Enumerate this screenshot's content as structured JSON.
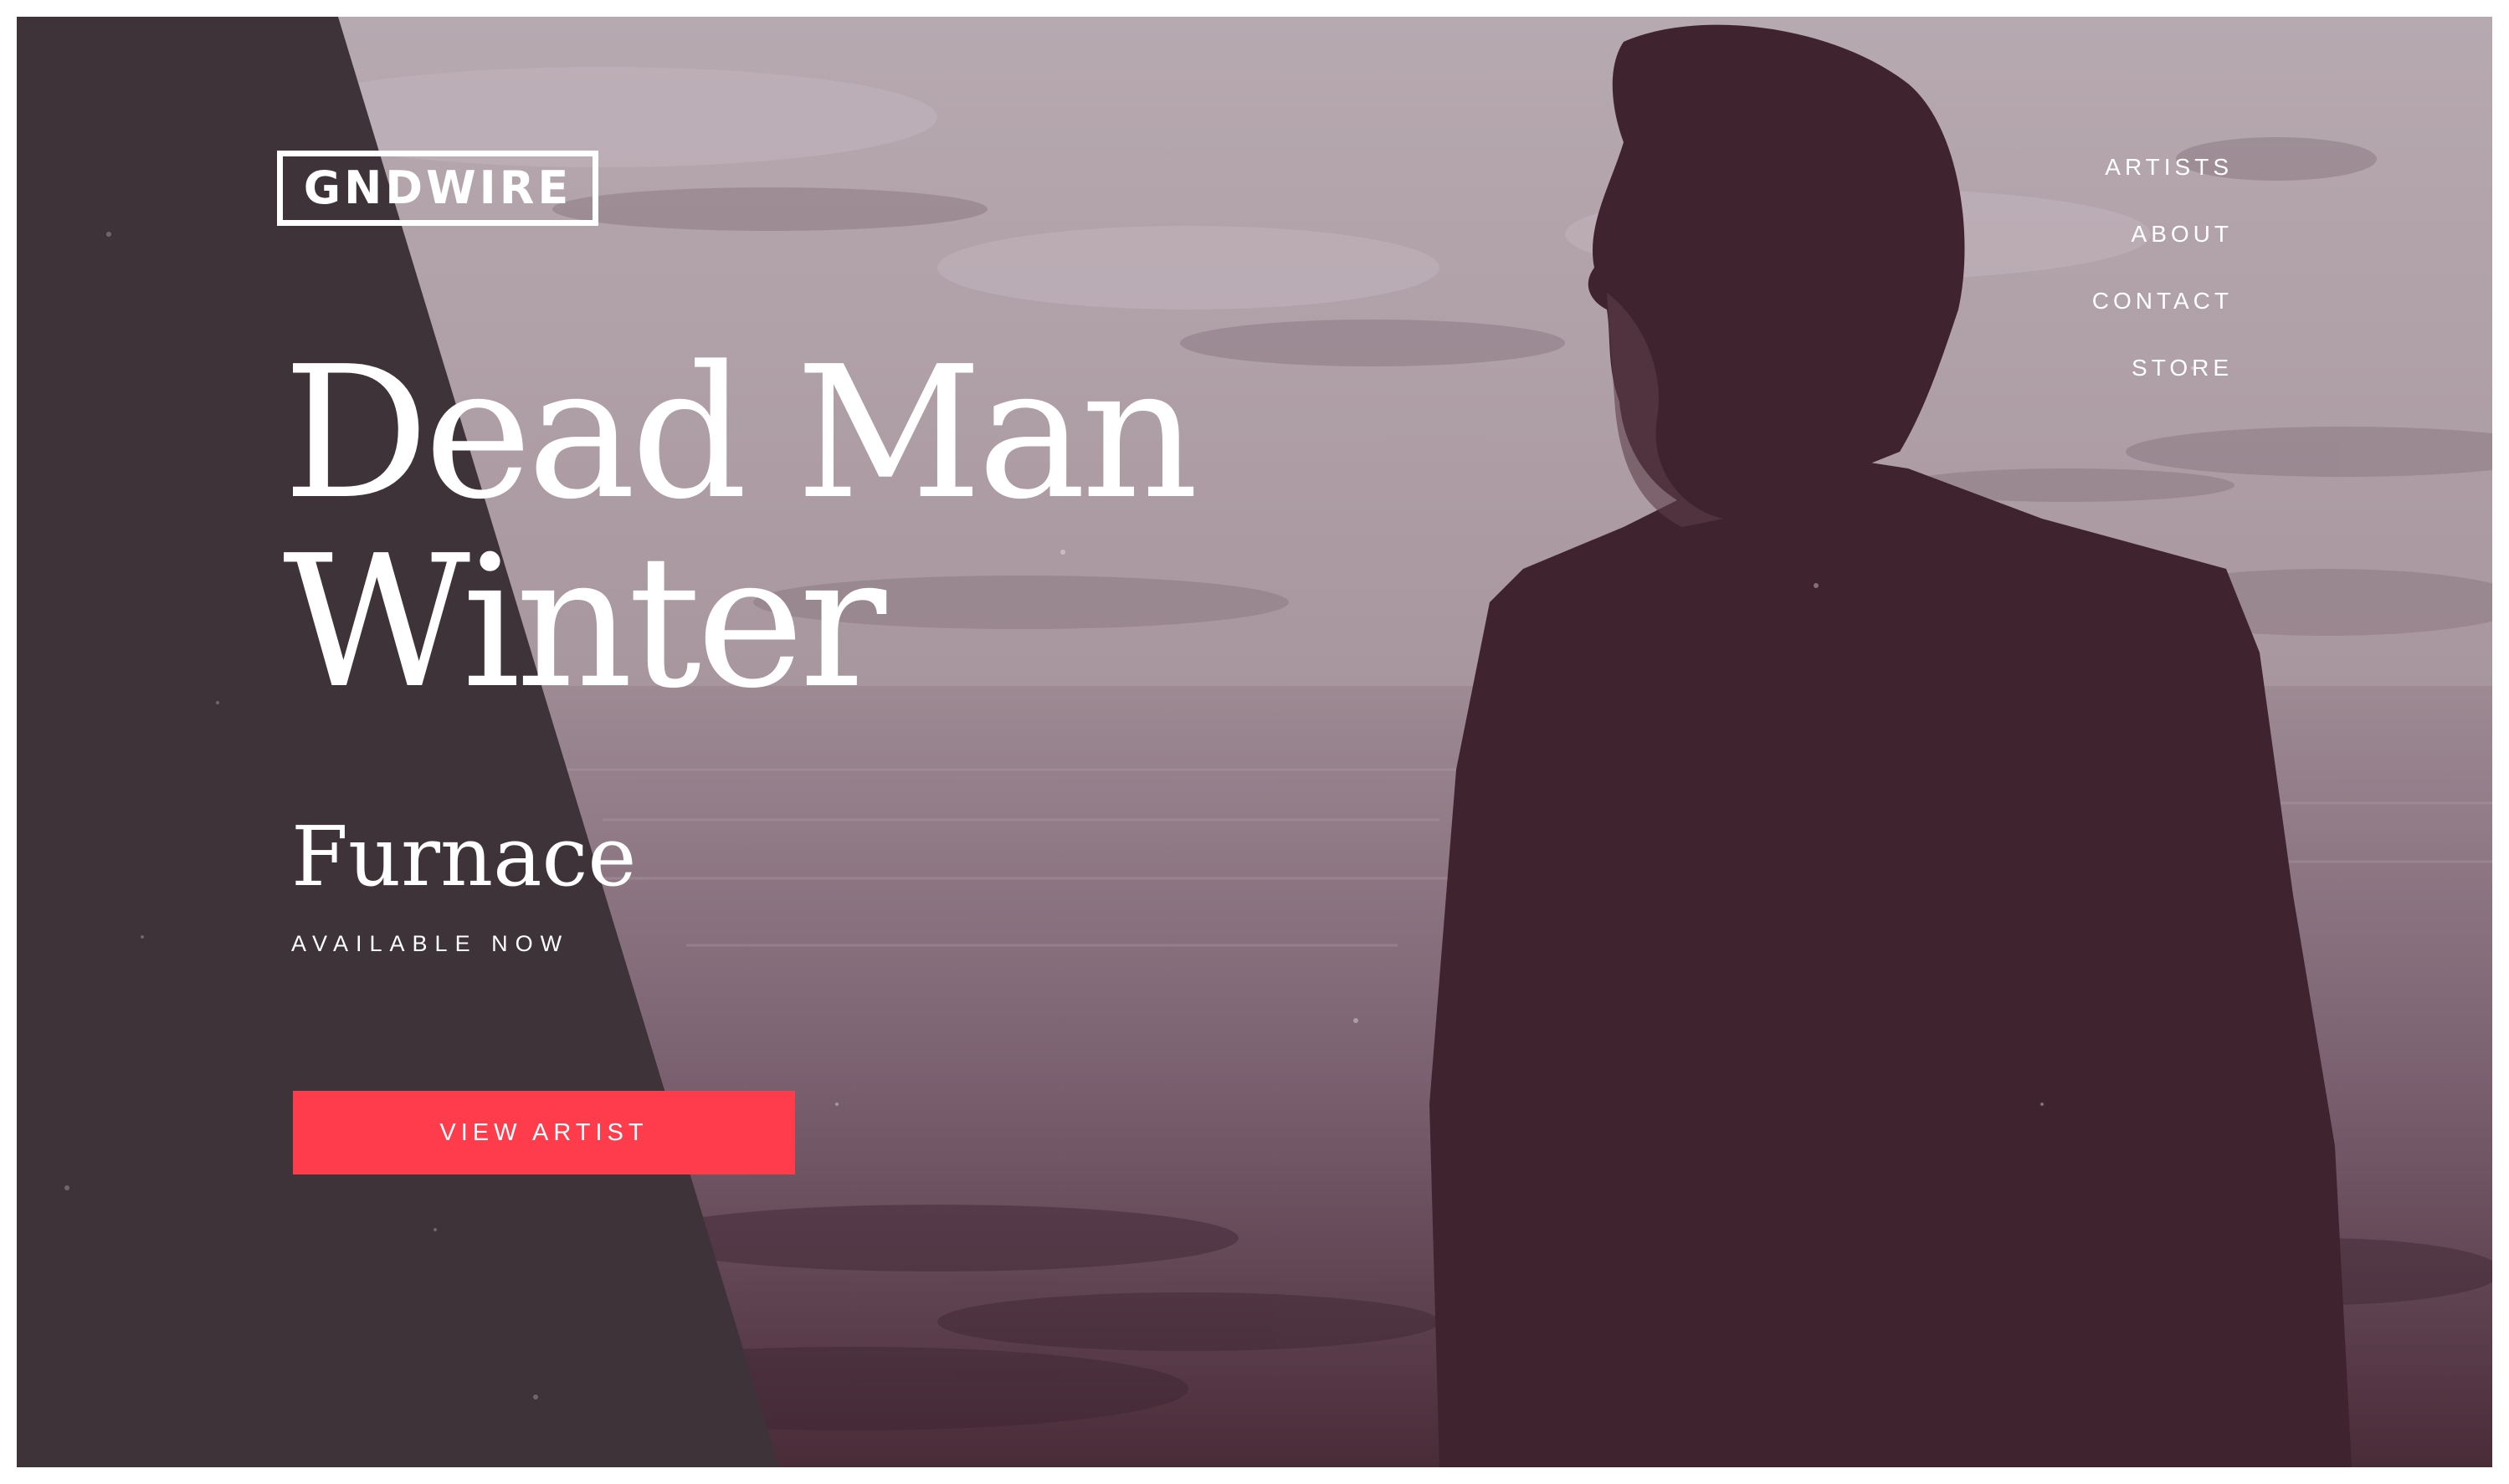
{
  "brand": {
    "logo_text": "GNDWIRE"
  },
  "nav": {
    "items": [
      {
        "label": "ARTISTS"
      },
      {
        "label": "ABOUT"
      },
      {
        "label": "CONTACT"
      },
      {
        "label": "STORE"
      }
    ]
  },
  "hero": {
    "artist_line1": "Dead Man",
    "artist_line2": "Winter",
    "album": "Furnace",
    "availability": "AVAILABLE NOW",
    "cta_label": "VIEW ARTIST"
  },
  "colors": {
    "panel_dark": "#3e3339",
    "photo_tint": "#a8979f",
    "silhouette": "#3f242f",
    "accent": "#ff3c4c",
    "text": "#ffffff"
  }
}
